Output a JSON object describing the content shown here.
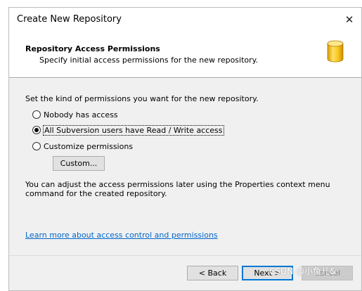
{
  "window": {
    "title": "Create New Repository"
  },
  "header": {
    "title": "Repository Access Permissions",
    "subtitle": "Specify initial access permissions for the new repository.",
    "icon": "database-icon",
    "icon_color": "#f5c518"
  },
  "main": {
    "prompt": "Set the kind of permissions you want for the new repository.",
    "options": [
      {
        "label": "Nobody has access",
        "selected": false
      },
      {
        "label": "All Subversion users have Read / Write access",
        "selected": true
      },
      {
        "label": "Customize permissions",
        "selected": false
      }
    ],
    "customize_button": "Custom...",
    "info": "You can adjust the access permissions later using the Properties context menu command for the created repository.",
    "help_link": "Learn more about access control and permissions"
  },
  "footer": {
    "back_label": "< Back",
    "next_label": "Next >",
    "cancel_label": "Cancel"
  },
  "watermark": "CSDN @小鱼儿&"
}
